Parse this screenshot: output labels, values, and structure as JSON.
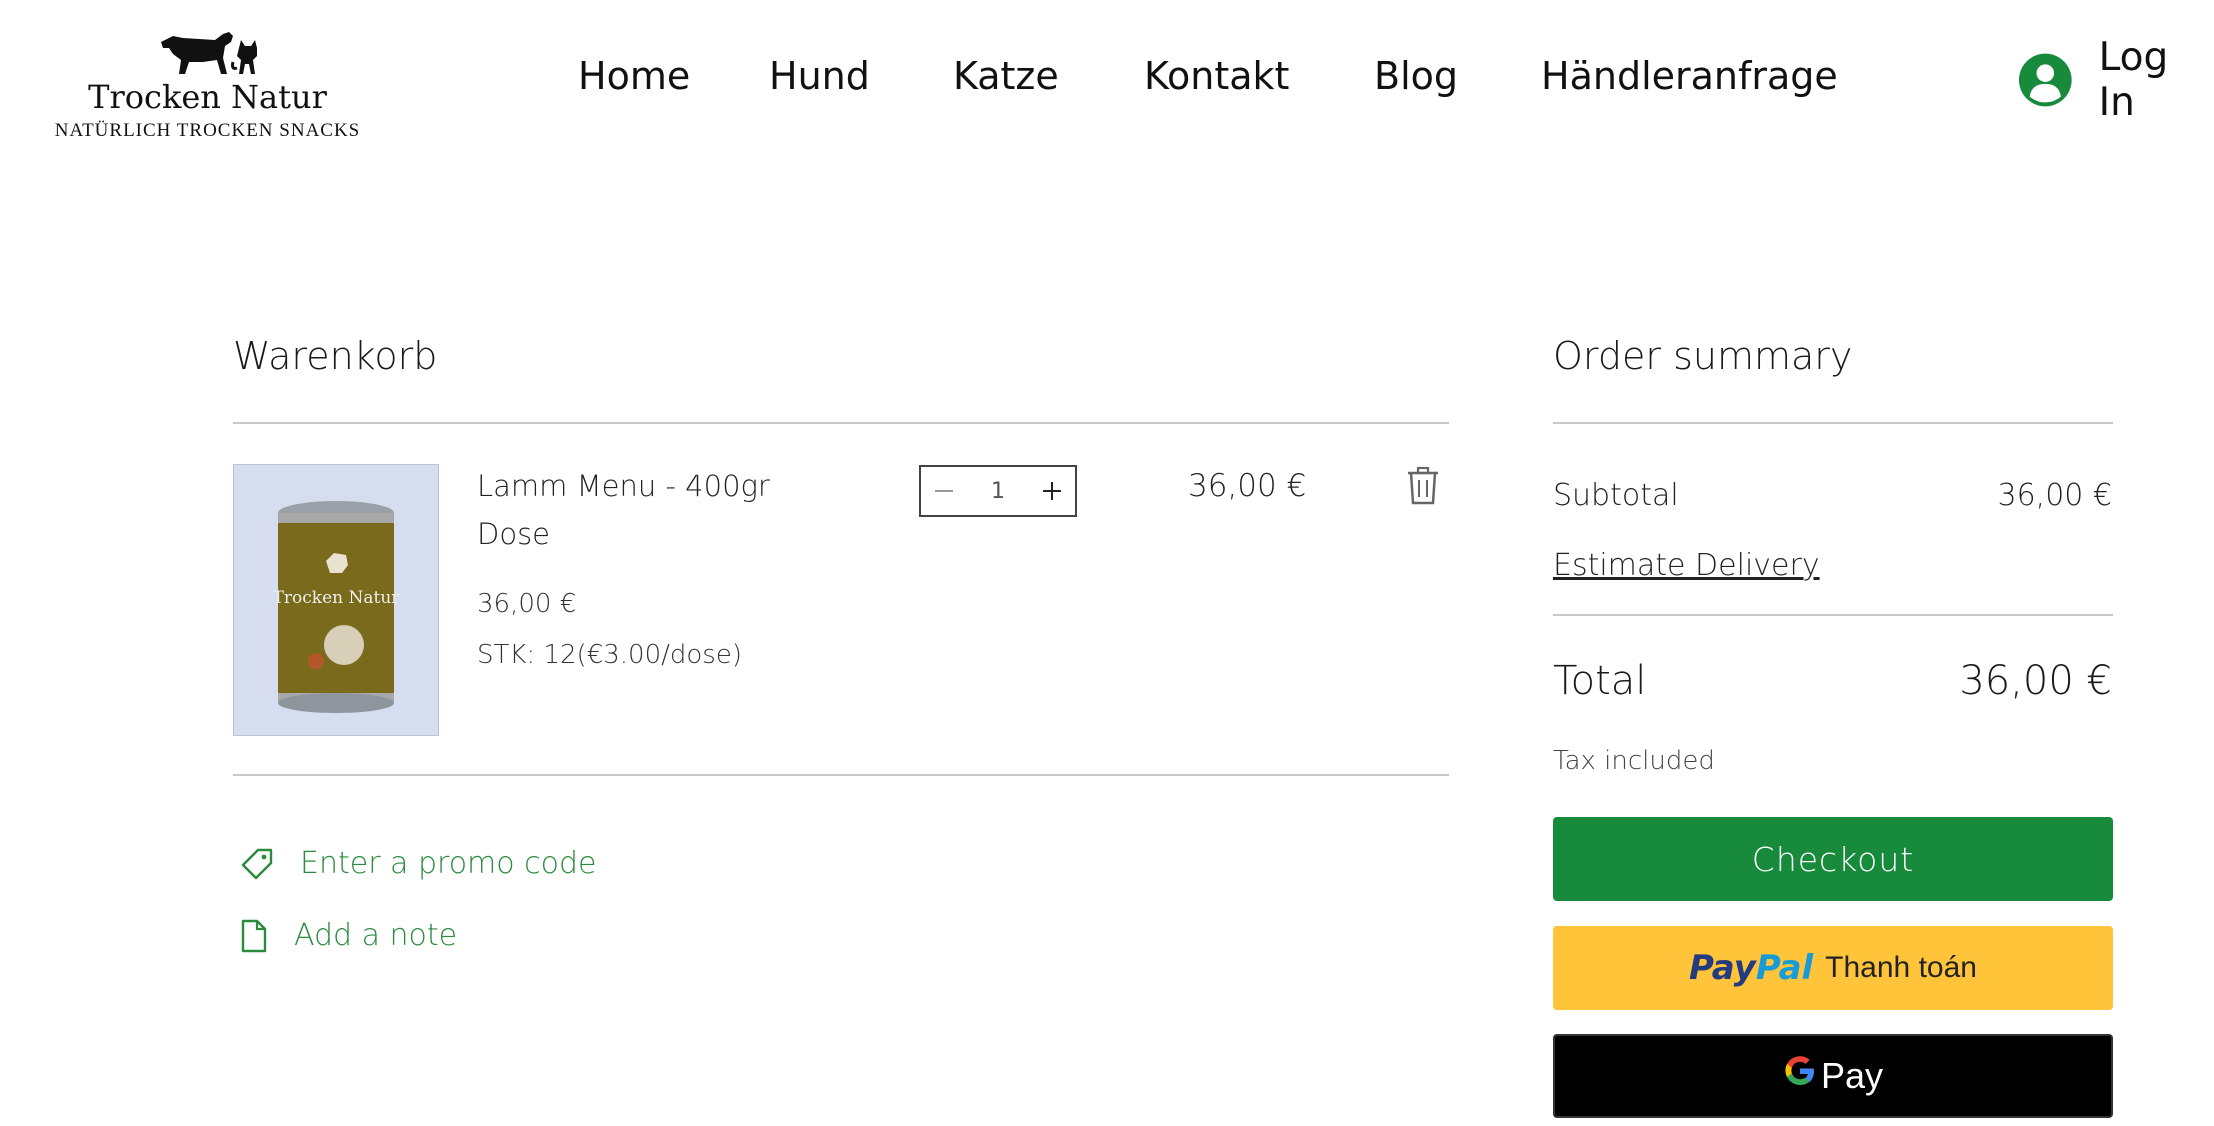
{
  "header": {
    "logo": {
      "name": "Trocken Natur",
      "tagline": "NATÜRLICH TROCKEN SNACKS"
    },
    "nav": [
      {
        "label": "Home"
      },
      {
        "label": "Hund"
      },
      {
        "label": "Katze"
      },
      {
        "label": "Kontakt"
      },
      {
        "label": "Blog"
      },
      {
        "label": "Händleranfrage"
      }
    ],
    "login_label": "Log In",
    "accent_color": "#178a3c"
  },
  "cart": {
    "title": "Warenkorb",
    "items": [
      {
        "name": "Lamm Menu - 400gr Dose",
        "price": "36,00 €",
        "option": "STK: 12(€3.00/dose)",
        "quantity": "1",
        "line_total": "36,00 €",
        "image_label": "Trocken Natur",
        "icons": {
          "decrease": "minus-icon",
          "increase": "plus-icon",
          "remove": "trash-icon"
        }
      }
    ],
    "promo_label": "Enter a promo code",
    "note_label": "Add a note",
    "link_color": "#2a8a3e"
  },
  "summary": {
    "title": "Order summary",
    "subtotal_label": "Subtotal",
    "subtotal_value": "36,00 €",
    "delivery_label": "Estimate Delivery",
    "total_label": "Total",
    "total_value": "36,00 €",
    "tax_note": "Tax included",
    "checkout_label": "Checkout",
    "paypal": {
      "logo_part1": "Pay",
      "logo_part2": "Pal",
      "text": "Thanh toán"
    },
    "gpay": {
      "logo": "G",
      "text": "Pay"
    }
  }
}
